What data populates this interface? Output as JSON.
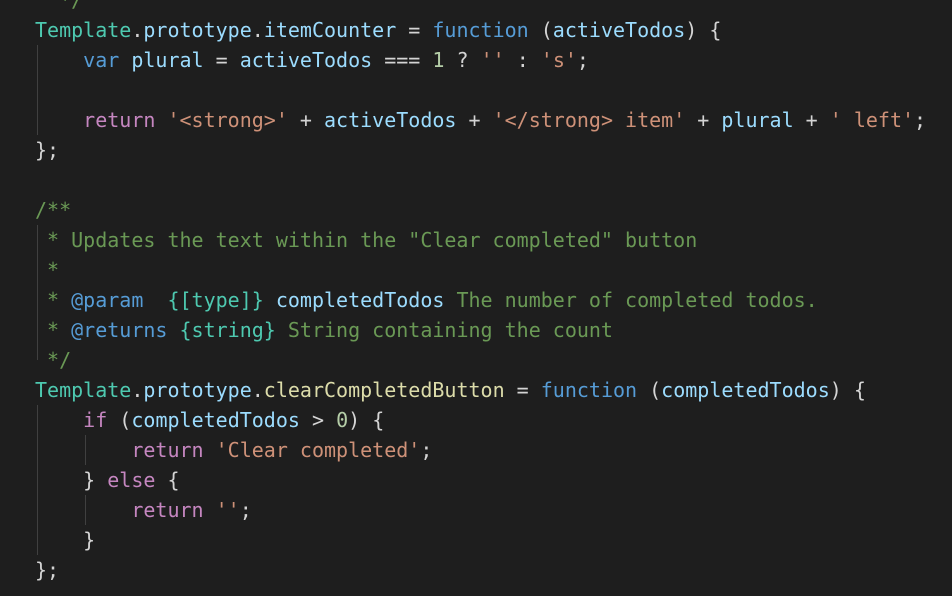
{
  "editor": {
    "language": "javascript",
    "theme": "dark",
    "background": "#1e1e1e",
    "lines": [
      [
        {
          "t": "  */",
          "c": "cm"
        }
      ],
      [
        {
          "t": "Template",
          "c": "kw-type"
        },
        {
          "t": ".",
          "c": "punc"
        },
        {
          "t": "prototype",
          "c": "var"
        },
        {
          "t": ".",
          "c": "punc"
        },
        {
          "t": "itemCounter",
          "c": "var"
        },
        {
          "t": " = ",
          "c": "punc"
        },
        {
          "t": "function",
          "c": "kw"
        },
        {
          "t": " (",
          "c": "punc"
        },
        {
          "t": "activeTodos",
          "c": "var"
        },
        {
          "t": ") {",
          "c": "punc"
        }
      ],
      [
        {
          "t": "    ",
          "c": "punc"
        },
        {
          "t": "var",
          "c": "kw"
        },
        {
          "t": " ",
          "c": "punc"
        },
        {
          "t": "plural",
          "c": "var"
        },
        {
          "t": " = ",
          "c": "punc"
        },
        {
          "t": "activeTodos",
          "c": "var"
        },
        {
          "t": " === ",
          "c": "punc"
        },
        {
          "t": "1",
          "c": "num"
        },
        {
          "t": " ? ",
          "c": "punc"
        },
        {
          "t": "''",
          "c": "str"
        },
        {
          "t": " : ",
          "c": "punc"
        },
        {
          "t": "'s'",
          "c": "str"
        },
        {
          "t": ";",
          "c": "punc"
        }
      ],
      [],
      [
        {
          "t": "    ",
          "c": "punc"
        },
        {
          "t": "return",
          "c": "kw-ctrl"
        },
        {
          "t": " ",
          "c": "punc"
        },
        {
          "t": "'<strong>'",
          "c": "str"
        },
        {
          "t": " + ",
          "c": "punc"
        },
        {
          "t": "activeTodos",
          "c": "var"
        },
        {
          "t": " + ",
          "c": "punc"
        },
        {
          "t": "'</strong> item'",
          "c": "str"
        },
        {
          "t": " + ",
          "c": "punc"
        },
        {
          "t": "plural",
          "c": "var"
        },
        {
          "t": " + ",
          "c": "punc"
        },
        {
          "t": "' left'",
          "c": "str"
        },
        {
          "t": ";",
          "c": "punc"
        }
      ],
      [
        {
          "t": "};",
          "c": "punc"
        }
      ],
      [],
      [
        {
          "t": "/**",
          "c": "cm"
        }
      ],
      [
        {
          "t": " * Updates the text within the \"Clear completed\" button",
          "c": "cm"
        }
      ],
      [
        {
          "t": " *",
          "c": "cm"
        }
      ],
      [
        {
          "t": " * ",
          "c": "cm"
        },
        {
          "t": "@param",
          "c": "cm-tag"
        },
        {
          "t": "  ",
          "c": "cm"
        },
        {
          "t": "{[type]}",
          "c": "cm-type"
        },
        {
          "t": " ",
          "c": "cm"
        },
        {
          "t": "completedTodos",
          "c": "cm-var"
        },
        {
          "t": " The number of completed todos.",
          "c": "cm"
        }
      ],
      [
        {
          "t": " * ",
          "c": "cm"
        },
        {
          "t": "@returns",
          "c": "cm-tag"
        },
        {
          "t": " ",
          "c": "cm"
        },
        {
          "t": "{string}",
          "c": "cm-type"
        },
        {
          "t": " String containing the count",
          "c": "cm"
        }
      ],
      [
        {
          "t": " */",
          "c": "cm"
        }
      ],
      [
        {
          "t": "Template",
          "c": "kw-type"
        },
        {
          "t": ".",
          "c": "punc"
        },
        {
          "t": "prototype",
          "c": "var"
        },
        {
          "t": ".",
          "c": "punc"
        },
        {
          "t": "clearCompletedButton",
          "c": "fn"
        },
        {
          "t": " = ",
          "c": "punc"
        },
        {
          "t": "function",
          "c": "kw"
        },
        {
          "t": " (",
          "c": "punc"
        },
        {
          "t": "completedTodos",
          "c": "var"
        },
        {
          "t": ") {",
          "c": "punc"
        }
      ],
      [
        {
          "t": "    ",
          "c": "punc"
        },
        {
          "t": "if",
          "c": "kw-ctrl"
        },
        {
          "t": " (",
          "c": "punc"
        },
        {
          "t": "completedTodos",
          "c": "var"
        },
        {
          "t": " > ",
          "c": "punc"
        },
        {
          "t": "0",
          "c": "num"
        },
        {
          "t": ") {",
          "c": "punc"
        }
      ],
      [
        {
          "t": "        ",
          "c": "punc"
        },
        {
          "t": "return",
          "c": "kw-ctrl"
        },
        {
          "t": " ",
          "c": "punc"
        },
        {
          "t": "'Clear completed'",
          "c": "str"
        },
        {
          "t": ";",
          "c": "punc"
        }
      ],
      [
        {
          "t": "    } ",
          "c": "punc"
        },
        {
          "t": "else",
          "c": "kw-ctrl"
        },
        {
          "t": " {",
          "c": "punc"
        }
      ],
      [
        {
          "t": "        ",
          "c": "punc"
        },
        {
          "t": "return",
          "c": "kw-ctrl"
        },
        {
          "t": " ",
          "c": "punc"
        },
        {
          "t": "''",
          "c": "str"
        },
        {
          "t": ";",
          "c": "punc"
        }
      ],
      [
        {
          "t": "    }",
          "c": "punc"
        }
      ],
      [
        {
          "t": "};",
          "c": "punc"
        }
      ]
    ]
  }
}
